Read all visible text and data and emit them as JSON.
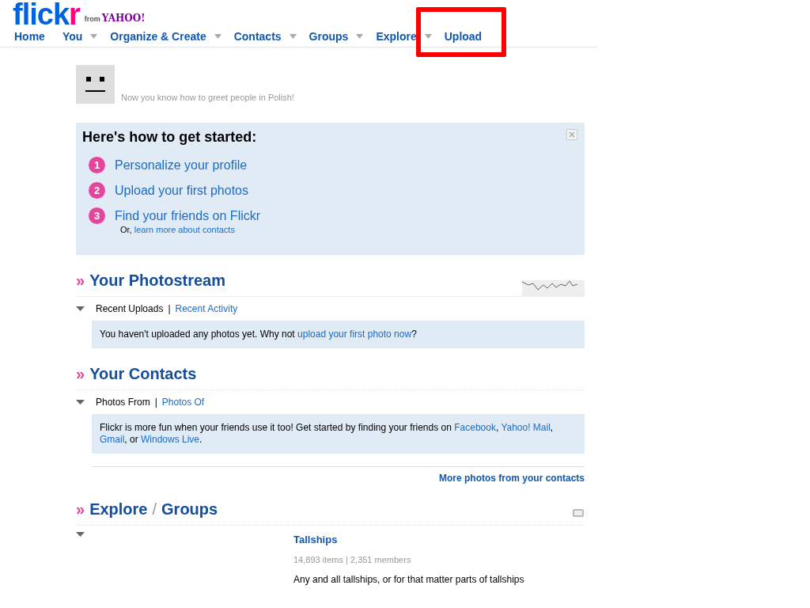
{
  "logo": {
    "parts": [
      "flick",
      "r"
    ],
    "suffix_from": "from",
    "suffix_brand": "YAHOO!"
  },
  "nav": [
    {
      "label": "Home",
      "has_menu": false,
      "highlighted": false
    },
    {
      "label": "You",
      "has_menu": true,
      "highlighted": false
    },
    {
      "label": "Organize & Create",
      "has_menu": true,
      "highlighted": false
    },
    {
      "label": "Contacts",
      "has_menu": true,
      "highlighted": false
    },
    {
      "label": "Groups",
      "has_menu": true,
      "highlighted": false
    },
    {
      "label": "Explore",
      "has_menu": true,
      "highlighted": false
    },
    {
      "label": "Upload",
      "has_menu": false,
      "highlighted": true
    }
  ],
  "greeting": "Now you know how to greet people in Polish!",
  "getting_started": {
    "title": "Here's how to get started:",
    "steps": [
      {
        "number": "1",
        "label": "Personalize your profile"
      },
      {
        "number": "2",
        "label": "Upload your first photos"
      },
      {
        "number": "3",
        "label": "Find your friends on Flickr"
      }
    ],
    "note": [
      {
        "text": "Or, "
      },
      {
        "link": "learn more about contacts"
      }
    ]
  },
  "sections": [
    {
      "prefix": "»",
      "title": [
        "Your Photostream"
      ],
      "sparkline": true,
      "slideshow": false,
      "separator": "|",
      "tabs": [
        {
          "label": "Recent Uploads",
          "selected": true
        },
        {
          "label": "Recent Activity",
          "selected": false
        }
      ],
      "message": [
        {
          "text": "You haven't uploaded any photos yet. Why not "
        },
        {
          "link": "upload your first photo now"
        },
        {
          "text": "?"
        }
      ]
    },
    {
      "prefix": "»",
      "title": [
        "Your Contacts"
      ],
      "sparkline": false,
      "slideshow": false,
      "separator": "|",
      "tabs": [
        {
          "label": "Photos From",
          "selected": true
        },
        {
          "label": "Photos Of",
          "selected": false
        }
      ],
      "message": [
        {
          "text": "Flickr is more fun when your friends use it too! Get started by finding your friends on "
        },
        {
          "link": "Facebook"
        },
        {
          "text": ", "
        },
        {
          "link": "Yahoo! Mail"
        },
        {
          "text": ", "
        },
        {
          "link": "Gmail"
        },
        {
          "text": ", or "
        },
        {
          "link": "Windows Live"
        },
        {
          "text": "."
        }
      ],
      "more_link": "More photos from your contacts"
    },
    {
      "prefix": "»",
      "title": [
        "Explore",
        "Groups"
      ],
      "joiner": "/",
      "sparkline": false,
      "slideshow": true,
      "group": {
        "name": "Tallships",
        "stats": "14,893 items | 2,351 members",
        "description": "Any and all tallships, or for that matter parts of tallships"
      }
    }
  ]
}
